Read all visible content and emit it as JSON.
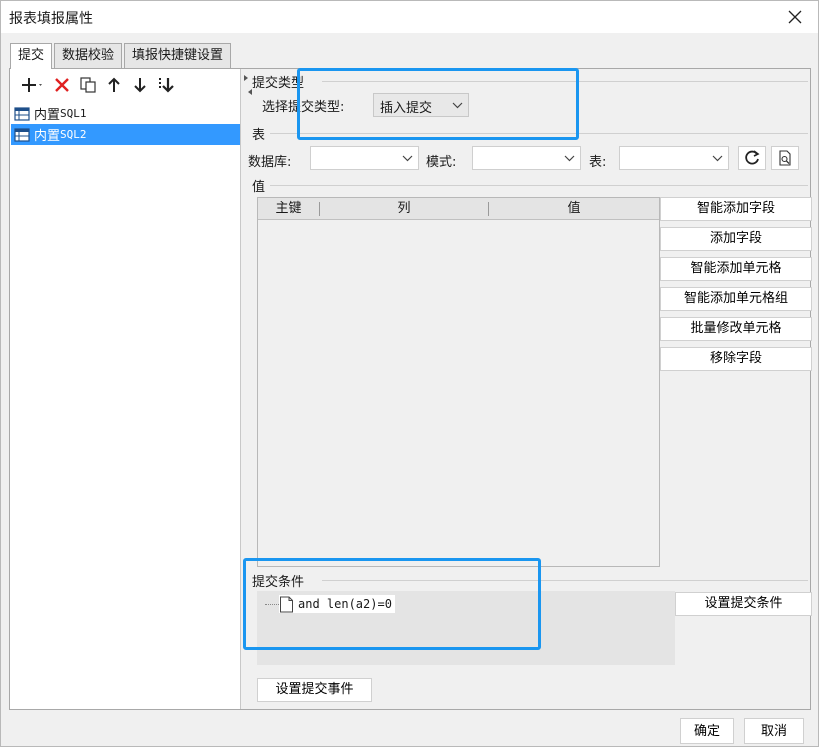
{
  "window": {
    "title": "报表填报属性"
  },
  "tabs": [
    {
      "label": "提交"
    },
    {
      "label": "数据校验"
    },
    {
      "label": "填报快捷键设置"
    }
  ],
  "left": {
    "toolbar": [
      "add-icon",
      "delete-icon",
      "copy-icon",
      "move-up-icon",
      "move-down-icon",
      "move-bottom-icon"
    ],
    "items": [
      {
        "prefix": "内置",
        "suffix": "SQL1"
      },
      {
        "prefix": "内置",
        "suffix": "SQL2"
      }
    ]
  },
  "submit_type": {
    "section_label": "提交类型",
    "select_label": "选择提交类型:",
    "value": "插入提交"
  },
  "table_section": {
    "section_label": "表",
    "database_label": "数据库:",
    "mode_label": "模式:",
    "table_label": "表:",
    "database_value": "",
    "mode_value": "",
    "table_value": ""
  },
  "value_section": {
    "section_label": "值",
    "columns": [
      "主键",
      "列",
      "值"
    ]
  },
  "field_buttons": [
    "智能添加字段",
    "添加字段",
    "智能添加单元格",
    "智能添加单元格组",
    "批量修改单元格",
    "移除字段"
  ],
  "condition": {
    "section_label": "提交条件",
    "expression": "and  len(a2)=0",
    "set_button": "设置提交条件"
  },
  "event_button": "设置提交事件",
  "footer": {
    "ok": "确定",
    "cancel": "取消"
  },
  "colors": {
    "selection": "#3399ff",
    "highlight": "#1a96f0",
    "delete": "#e02020"
  }
}
